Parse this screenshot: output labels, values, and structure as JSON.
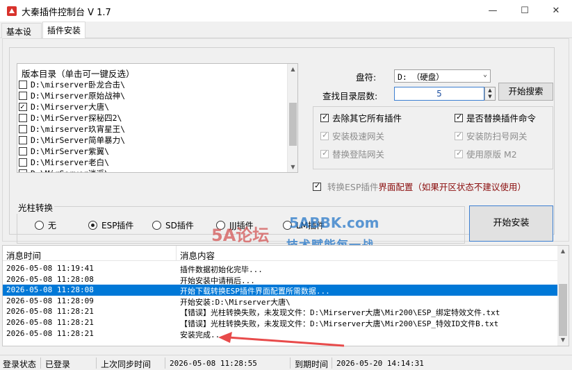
{
  "window": {
    "title": "大秦插件控制台 V 1.7",
    "controls": {
      "minimize": "—",
      "maximize": "☐",
      "close": "✕"
    }
  },
  "tabs": [
    {
      "label": "基本设置",
      "active": false
    },
    {
      "label": "插件安装",
      "active": true
    }
  ],
  "version_list": {
    "header": "版本目录（单击可一键反选）",
    "items": [
      {
        "label": "D:\\mirserver卧龙合击\\",
        "checked": false
      },
      {
        "label": "D:\\Mirserver原始战神\\",
        "checked": false
      },
      {
        "label": "D:\\Mirserver大唐\\",
        "checked": true
      },
      {
        "label": "D:\\MirServer探秘四2\\",
        "checked": false
      },
      {
        "label": "D:\\mirserver玖宵星王\\",
        "checked": false
      },
      {
        "label": "D:\\MirServer简单暴力\\",
        "checked": false
      },
      {
        "label": "D:\\MirServer紫翼\\",
        "checked": false
      },
      {
        "label": "D:\\Mirserver老白\\",
        "checked": false
      },
      {
        "label": "D:\\MirServer逍遥\\",
        "checked": false
      }
    ]
  },
  "search": {
    "drive_label": "盘符:",
    "drive_value": "D: （硬盘）",
    "depth_label": "查找目录层数:",
    "depth_value": "5",
    "search_button": "开始搜索"
  },
  "options": [
    {
      "label": "去除其它所有插件",
      "checked": true,
      "disabled": false
    },
    {
      "label": "是否替换插件命令",
      "checked": true,
      "disabled": false
    },
    {
      "label": "安装极速网关",
      "checked": true,
      "disabled": true
    },
    {
      "label": "安装防扫号网关",
      "checked": true,
      "disabled": true
    },
    {
      "label": "替换登陆网关",
      "checked": true,
      "disabled": true
    },
    {
      "label": "使用原版 M2",
      "checked": true,
      "disabled": true
    }
  ],
  "esp_option": {
    "label_a": "转换ESP插件",
    "label_b": "界面配置（如果开区状态不建议使用）"
  },
  "light_pillar": {
    "caption": "光柱转换",
    "options": [
      {
        "label": "无",
        "selected": false
      },
      {
        "label": "ESP插件",
        "selected": true
      },
      {
        "label": "SD插件",
        "selected": false
      },
      {
        "label": "JJJ插件",
        "selected": false
      },
      {
        "label": "LM插件",
        "selected": false
      }
    ]
  },
  "install_button": "开始安装",
  "watermark": {
    "logo": "5A论坛",
    "site": "5ABBK.com",
    "slogan": "技术赋能每一战"
  },
  "log": {
    "columns": [
      "消息时间",
      "消息内容"
    ],
    "rows": [
      {
        "time": "2026-05-08 11:19:41",
        "message": "插件数据初始化完毕...",
        "selected": false
      },
      {
        "time": "2026-05-08 11:28:08",
        "message": "开始安装中请稍后...",
        "selected": false
      },
      {
        "time": "2026-05-08 11:28:08",
        "message": "开始下载转换ESP插件界面配置所需数据...",
        "selected": true
      },
      {
        "time": "2026-05-08 11:28:09",
        "message": "开始安装:D:\\Mirserver大唐\\",
        "selected": false
      },
      {
        "time": "2026-05-08 11:28:21",
        "message": "【错误】光柱转换失败，未发现文件：D:\\Mirserver大唐\\Mir200\\ESP_绑定特效文件.txt",
        "selected": false
      },
      {
        "time": "2026-05-08 11:28:21",
        "message": "【错误】光柱转换失败，未发现文件：D:\\Mirserver大唐\\Mir200\\ESP_特效ID文件B.txt",
        "selected": false
      },
      {
        "time": "2026-05-08 11:28:21",
        "message": "安装完成...",
        "selected": false
      }
    ]
  },
  "statusbar": {
    "login_label": "登录状态",
    "login_value": "已登录",
    "sync_label": "上次同步时间",
    "sync_value": "2026-05-08 11:28:55",
    "expire_label": "到期时间",
    "expire_value": "2026-05-20 14:14:31"
  },
  "colors": {
    "accent": "#0078d7",
    "warning_text": "#8a0c0c",
    "annotation_arrow": "#e84b4b"
  }
}
